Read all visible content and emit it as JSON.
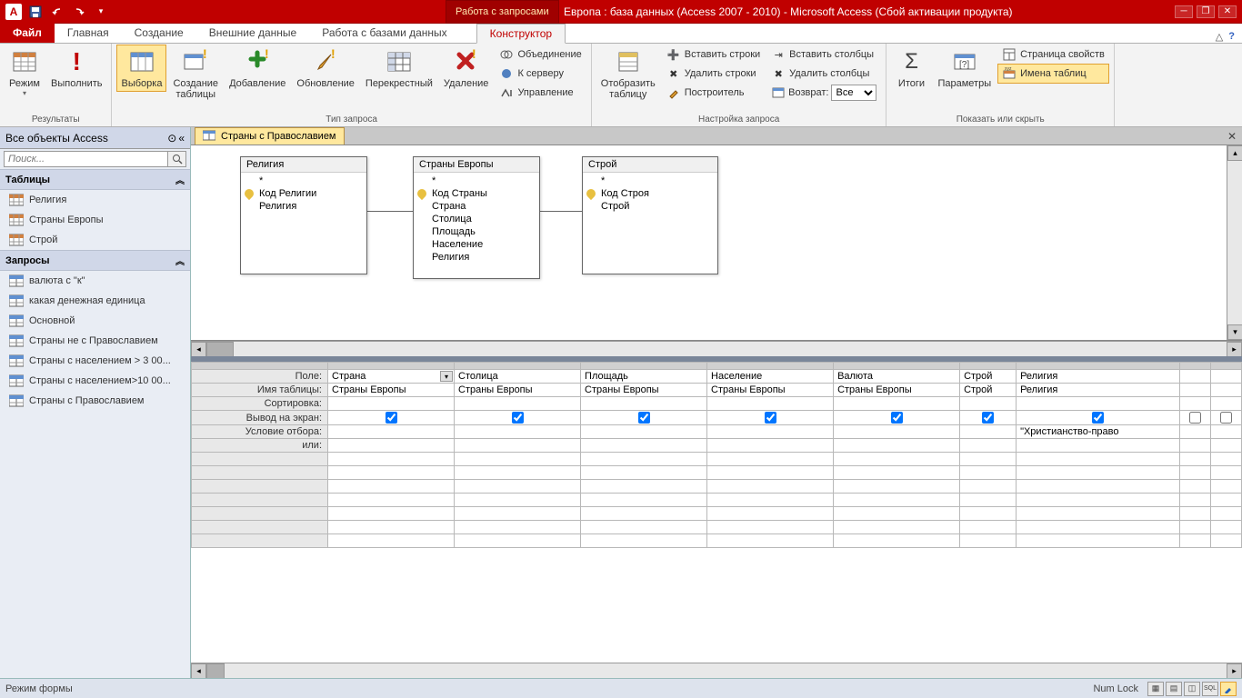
{
  "title_bar": {
    "context_label": "Работа с запросами",
    "title": "Европа : база данных (Access 2007 - 2010)  -  Microsoft Access (Сбой активации продукта)"
  },
  "tabs": {
    "file": "Файл",
    "home": "Главная",
    "create": "Создание",
    "external": "Внешние данные",
    "dbtools": "Работа с базами данных",
    "design": "Конструктор"
  },
  "ribbon": {
    "results": {
      "label": "Результаты",
      "view": "Режим",
      "run": "Выполнить"
    },
    "query_type": {
      "label": "Тип запроса",
      "select": "Выборка",
      "maketable": "Создание\nтаблицы",
      "append": "Добавление",
      "update": "Обновление",
      "crosstab": "Перекрестный",
      "delete": "Удаление",
      "union": "Объединение",
      "passthrough": "К серверу",
      "datadef": "Управление"
    },
    "query_setup": {
      "label": "Настройка запроса",
      "showtable": "Отобразить\nтаблицу",
      "insert_rows": "Вставить строки",
      "delete_rows": "Удалить строки",
      "builder": "Построитель",
      "insert_cols": "Вставить столбцы",
      "delete_cols": "Удалить столбцы",
      "return_label": "Возврат:",
      "return_value": "Все"
    },
    "show_hide": {
      "label": "Показать или скрыть",
      "totals": "Итоги",
      "params": "Параметры",
      "propsheet": "Страница свойств",
      "tablenames": "Имена таблиц"
    }
  },
  "nav": {
    "header": "Все объекты Access",
    "search_placeholder": "Поиск...",
    "tables_label": "Таблицы",
    "tables": [
      "Религия",
      "Страны Европы",
      "Строй"
    ],
    "queries_label": "Запросы",
    "queries": [
      "валюта с \"к\"",
      "какая денежная единица",
      "Основной",
      "Страны не с Православием",
      "Страны с населением > 3 00...",
      "Страны с населением>10 00...",
      "Страны с Православием"
    ]
  },
  "doc": {
    "tab_title": "Страны с Православием"
  },
  "field_lists": {
    "religion": {
      "title": "Религия",
      "star": "*",
      "pk": "Код Религии",
      "f1": "Религия"
    },
    "countries": {
      "title": "Страны Европы",
      "star": "*",
      "pk": "Код Страны",
      "f1": "Страна",
      "f2": "Столица",
      "f3": "Площадь",
      "f4": "Население",
      "f5": "Религия"
    },
    "regime": {
      "title": "Строй",
      "star": "*",
      "pk": "Код Строя",
      "f1": "Строй"
    }
  },
  "grid": {
    "row_field": "Поле:",
    "row_table": "Имя таблицы:",
    "row_sort": "Сортировка:",
    "row_show": "Вывод на экран:",
    "row_criteria": "Условие отбора:",
    "row_or": "или:",
    "cols": [
      {
        "field": "Страна",
        "table": "Страны Европы",
        "show": true,
        "criteria": "",
        "active": true
      },
      {
        "field": "Столица",
        "table": "Страны Европы",
        "show": true,
        "criteria": ""
      },
      {
        "field": "Площадь",
        "table": "Страны Европы",
        "show": true,
        "criteria": ""
      },
      {
        "field": "Население",
        "table": "Страны Европы",
        "show": true,
        "criteria": ""
      },
      {
        "field": "Валюта",
        "table": "Страны Европы",
        "show": true,
        "criteria": ""
      },
      {
        "field": "Строй",
        "table": "Строй",
        "show": true,
        "criteria": ""
      },
      {
        "field": "Религия",
        "table": "Религия",
        "show": true,
        "criteria": "\"Христианство-право"
      },
      {
        "field": "",
        "table": "",
        "show": false,
        "criteria": ""
      },
      {
        "field": "",
        "table": "",
        "show": false,
        "criteria": ""
      }
    ]
  },
  "status": {
    "mode": "Режим формы",
    "numlock": "Num Lock"
  }
}
